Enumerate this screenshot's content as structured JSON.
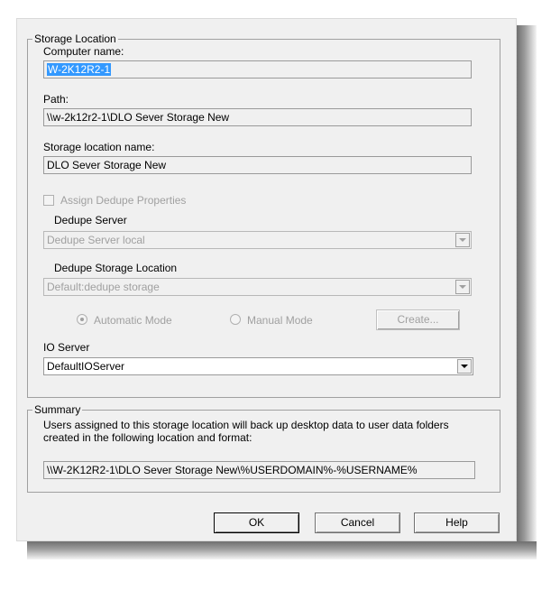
{
  "storage_group": {
    "legend": "Storage Location",
    "computer_name_label": "Computer name:",
    "computer_name_value": "W-2K12R2-1",
    "path_label": "Path:",
    "path_value": "\\\\w-2k12r2-1\\DLO Sever Storage New",
    "location_name_label": "Storage location name:",
    "location_name_value": "DLO Sever Storage New",
    "assign_dedupe_label": "Assign Dedupe Properties",
    "assign_dedupe_checked": false,
    "dedupe_server_label": "Dedupe Server",
    "dedupe_server_value": "Dedupe Server local",
    "dedupe_location_label": "Dedupe Storage Location",
    "dedupe_location_value": "Default:dedupe storage",
    "automatic_mode_label": "Automatic Mode",
    "manual_mode_label": "Manual Mode",
    "selected_mode": "Automatic Mode",
    "create_label": "Create...",
    "io_server_label": "IO Server",
    "io_server_value": "DefaultIOServer"
  },
  "summary_group": {
    "legend": "Summary",
    "description": "Users assigned to this storage location will back up desktop data to user data folders created in the following location and format:",
    "path_format": "\\\\W-2K12R2-1\\DLO Sever Storage New\\%USERDOMAIN%-%USERNAME%"
  },
  "buttons": {
    "ok": "OK",
    "cancel": "Cancel",
    "help": "Help"
  },
  "icons": {
    "dropdown": "chevron-down-icon"
  }
}
